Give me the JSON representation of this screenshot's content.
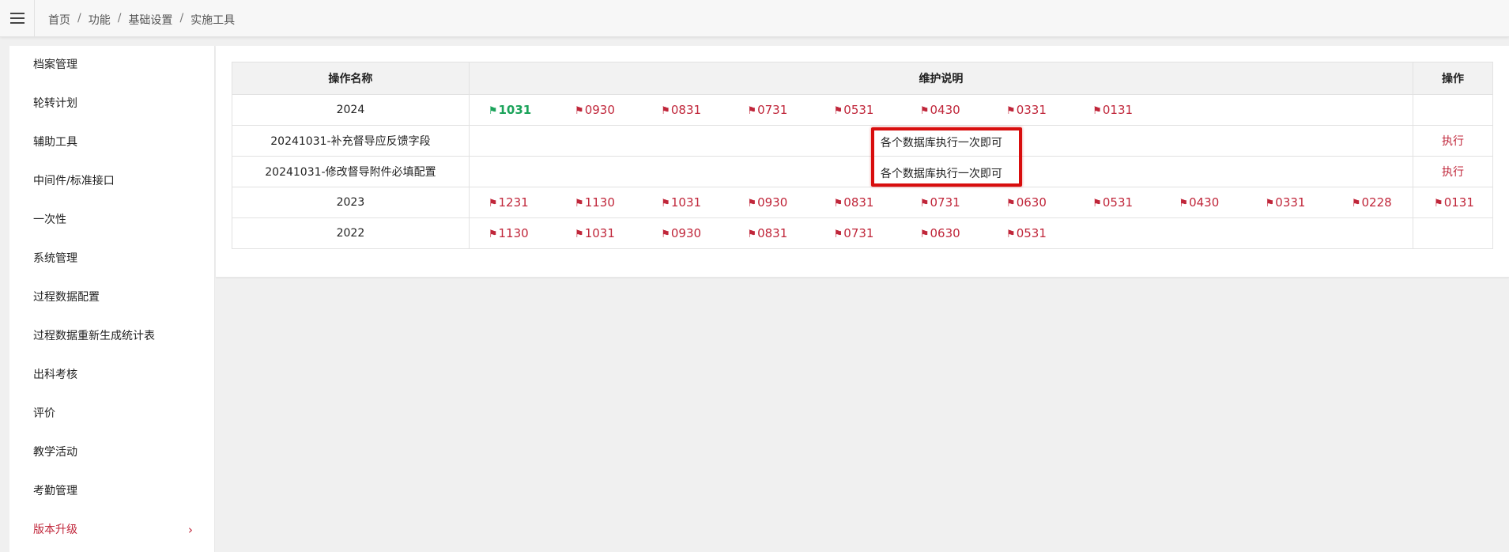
{
  "breadcrumb": [
    "首页",
    "功能",
    "基础设置",
    "实施工具"
  ],
  "sidebar": {
    "items": [
      {
        "label": "档案管理"
      },
      {
        "label": "轮转计划"
      },
      {
        "label": "辅助工具"
      },
      {
        "label": "中间件/标准接口"
      },
      {
        "label": "一次性"
      },
      {
        "label": "系统管理"
      },
      {
        "label": "过程数据配置"
      },
      {
        "label": "过程数据重新生成统计表"
      },
      {
        "label": "出科考核"
      },
      {
        "label": "评价"
      },
      {
        "label": "教学活动"
      },
      {
        "label": "考勤管理"
      },
      {
        "label": "版本升级",
        "active": true,
        "chevron": "›"
      }
    ]
  },
  "table": {
    "headers": [
      "操作名称",
      "维护说明",
      "操作"
    ],
    "rows": [
      {
        "name": "2024",
        "flags": [
          "1031",
          "0930",
          "0831",
          "0731",
          "0531",
          "0430",
          "0331",
          "0131"
        ],
        "current_flag": "1031"
      },
      {
        "name": "20241031-补充督导应反馈字段",
        "note": "各个数据库执行一次即可",
        "action": "执行"
      },
      {
        "name": "20241031-修改督导附件必填配置",
        "note": "各个数据库执行一次即可",
        "action": "执行"
      },
      {
        "name": "2023",
        "flags": [
          "1231",
          "1130",
          "1031",
          "0930",
          "0831",
          "0731",
          "0630",
          "0531",
          "0430",
          "0331",
          "0228",
          "0131"
        ]
      },
      {
        "name": "2022",
        "flags": [
          "1130",
          "1031",
          "0930",
          "0831",
          "0731",
          "0630",
          "0531"
        ]
      }
    ]
  },
  "colors": {
    "accent": "#c0263a",
    "current": "#1ba35a",
    "highlight": "#d80d0d"
  },
  "icons": {
    "flag": "flag-icon",
    "menu": "hamburger-menu-icon",
    "chevron": "chevron-right-icon"
  }
}
